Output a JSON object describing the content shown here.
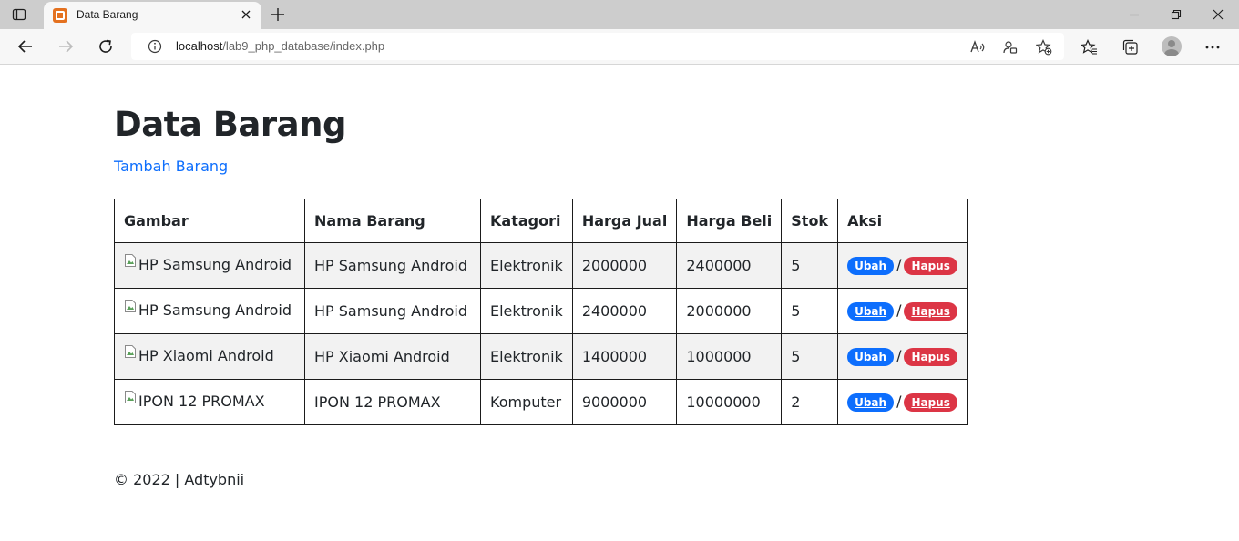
{
  "browser": {
    "tab_title": "Data Barang",
    "url_host": "localhost",
    "url_path": "/lab9_php_database/index.php"
  },
  "page": {
    "title": "Data Barang",
    "add_link": "Tambah Barang",
    "table": {
      "headers": [
        "Gambar",
        "Nama Barang",
        "Katagori",
        "Harga Jual",
        "Harga Beli",
        "Stok",
        "Aksi"
      ],
      "rows": [
        {
          "gambar_alt": "HP Samsung Android",
          "nama": "HP Samsung Android",
          "kategori": "Elektronik",
          "harga_jual": "2000000",
          "harga_beli": "2400000",
          "stok": "5"
        },
        {
          "gambar_alt": "HP Samsung Android",
          "nama": "HP Samsung Android",
          "kategori": "Elektronik",
          "harga_jual": "2400000",
          "harga_beli": "2000000",
          "stok": "5"
        },
        {
          "gambar_alt": "HP Xiaomi Android",
          "nama": "HP Xiaomi Android",
          "kategori": "Elektronik",
          "harga_jual": "1400000",
          "harga_beli": "1000000",
          "stok": "5"
        },
        {
          "gambar_alt": "IPON 12 PROMAX",
          "nama": "IPON 12 PROMAX",
          "kategori": "Komputer",
          "harga_jual": "9000000",
          "harga_beli": "10000000",
          "stok": "2"
        }
      ],
      "action_edit": "Ubah",
      "action_separator": "/",
      "action_delete": "Hapus"
    },
    "footer": "© 2022 | Adtybnii"
  },
  "colors": {
    "link": "#0d6efd",
    "edit_badge": "#0d6efd",
    "delete_badge": "#dc3545",
    "striped_row": "#f2f2f2"
  }
}
